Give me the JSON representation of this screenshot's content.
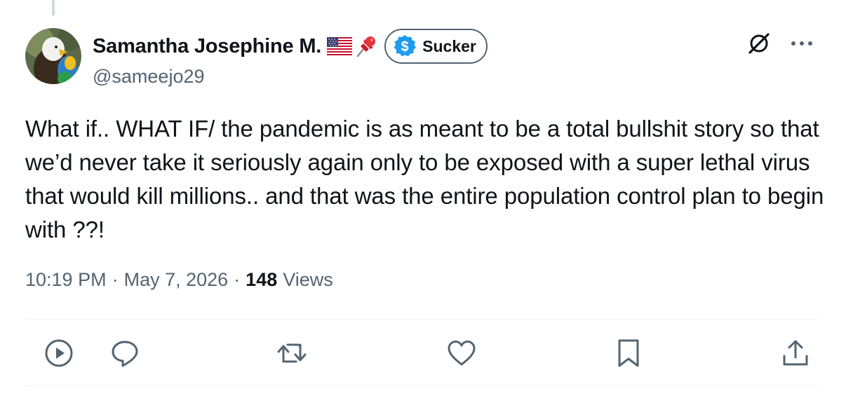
{
  "author": {
    "display_name": "Samantha Josephine M.",
    "handle": "@sameejo29",
    "emojis": [
      "us-flag",
      "pushpin"
    ],
    "badge": {
      "label": "Sucker",
      "icon": "dollar-icon",
      "icon_color": "#1d9bf0"
    }
  },
  "tweet": {
    "text": "What if.. WHAT IF/ the pandemic is as meant to be a total bullshit story so that we’d never take it seriously again only to be exposed with a super lethal virus that would kill millions.. and that was the entire population control plan to begin with ??!",
    "time": "10:19 PM",
    "date": "May 7, 2026",
    "separator": "·",
    "views_count": "148",
    "views_label": "Views"
  },
  "top_actions": [
    "grok-icon",
    "more-icon"
  ],
  "actions": [
    "view-icon",
    "reply-icon",
    "retweet-icon",
    "like-icon",
    "bookmark-icon",
    "share-icon"
  ],
  "colors": {
    "text": "#0f1419",
    "secondary": "#536471",
    "divider": "#eff3f4",
    "accent": "#1d9bf0"
  }
}
